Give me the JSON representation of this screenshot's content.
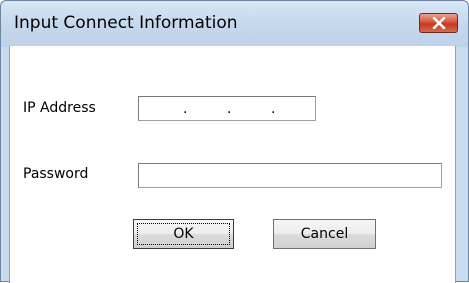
{
  "window": {
    "title": "Input Connect Information"
  },
  "form": {
    "ip_label": "IP Address",
    "ip_separator": ".",
    "password_label": "Password",
    "password_value": ""
  },
  "buttons": {
    "ok_label": "OK",
    "cancel_label": "Cancel"
  },
  "colors": {
    "title_bg": "#c4d7ec",
    "close_button": "#c23a1f"
  }
}
